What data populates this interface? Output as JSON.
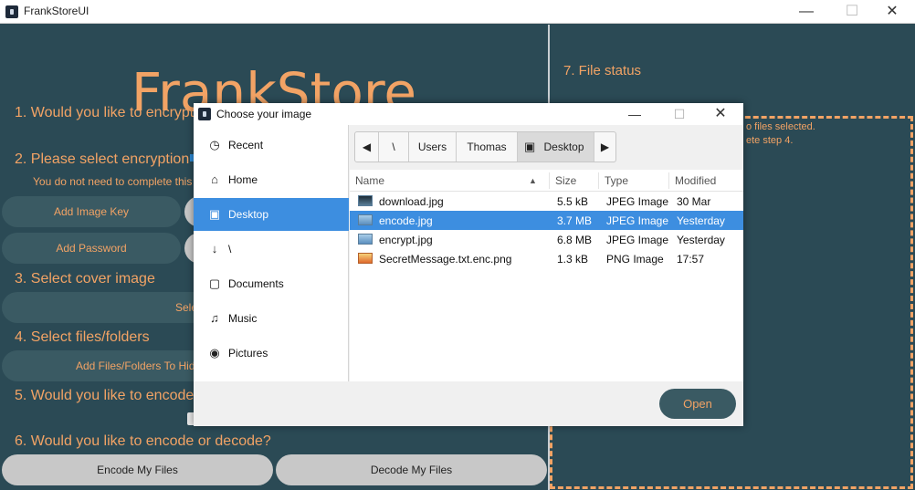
{
  "window": {
    "title": "FrankStoreUI"
  },
  "brand": "FrankStore",
  "steps": {
    "s1": "1. Would you like to encrypt",
    "s2": "2. Please select encryption pa",
    "s2_hint": "You do not need to complete this",
    "s3": "3. Select cover image",
    "s4": "4. Select files/folders",
    "s5": "5. Would you like to encode",
    "s6": "6. Would you like to encode or decode?",
    "s7": "7. File status"
  },
  "buttons": {
    "add_image_key": "Add Image Key",
    "add_password": "Add Password",
    "select_cover": "Sele",
    "add_files": "Add Files/Folders To Hid",
    "encode": "Encode My Files",
    "decode": "Decode My Files"
  },
  "status": {
    "line1": "o files selected.",
    "line2": "ete step 4."
  },
  "dialog": {
    "title": "Choose your image",
    "places": [
      {
        "label": "Recent",
        "icon": "clock-icon"
      },
      {
        "label": "Home",
        "icon": "home-icon"
      },
      {
        "label": "Desktop",
        "icon": "folder-icon",
        "selected": true
      },
      {
        "label": "\\",
        "icon": "download-icon"
      },
      {
        "label": "Documents",
        "icon": "document-icon"
      },
      {
        "label": "Music",
        "icon": "music-icon"
      },
      {
        "label": "Pictures",
        "icon": "camera-icon"
      }
    ],
    "breadcrumbs": [
      "\\",
      "Users",
      "Thomas",
      "Desktop"
    ],
    "columns": {
      "name": "Name",
      "size": "Size",
      "type": "Type",
      "modified": "Modified"
    },
    "files": [
      {
        "name": "download.jpg",
        "size": "5.5 kB",
        "type": "JPEG Image",
        "modified": "30 Mar"
      },
      {
        "name": "encode.jpg",
        "size": "3.7 MB",
        "type": "JPEG Image",
        "modified": "Yesterday",
        "selected": true
      },
      {
        "name": "encrypt.jpg",
        "size": "6.8 MB",
        "type": "JPEG Image",
        "modified": "Yesterday"
      },
      {
        "name": "SecretMessage.txt.enc.png",
        "size": "1.3 kB",
        "type": "PNG Image",
        "modified": "17:57"
      }
    ],
    "open_label": "Open"
  },
  "colors": {
    "background": "#2b4a55",
    "accent": "#f2a365",
    "selection": "#3d8ee0",
    "pill": "#3a5a63"
  }
}
